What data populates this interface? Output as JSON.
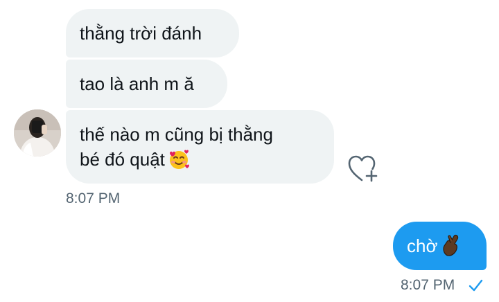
{
  "conversation": {
    "received": [
      {
        "text": "thằng trời đánh"
      },
      {
        "text": "tao là anh m ă"
      },
      {
        "line1": "thế nào m cũng bị thằng",
        "line2": "bé đó quật",
        "emoji": "smiling-face-with-hearts"
      }
    ],
    "received_time": "8:07 PM",
    "sent": [
      {
        "text": "chờ",
        "emoji": "crossed-fingers-dark-skin"
      }
    ],
    "sent_time": "8:07 PM",
    "sent_status": "seen-check"
  },
  "colors": {
    "received_bubble": "#eff3f4",
    "sent_bubble": "#1d9bf0",
    "timestamp": "#536471",
    "accent": "#1d9bf0"
  },
  "icons": {
    "reaction": "heart-plus-icon",
    "status": "checkmark-icon"
  }
}
